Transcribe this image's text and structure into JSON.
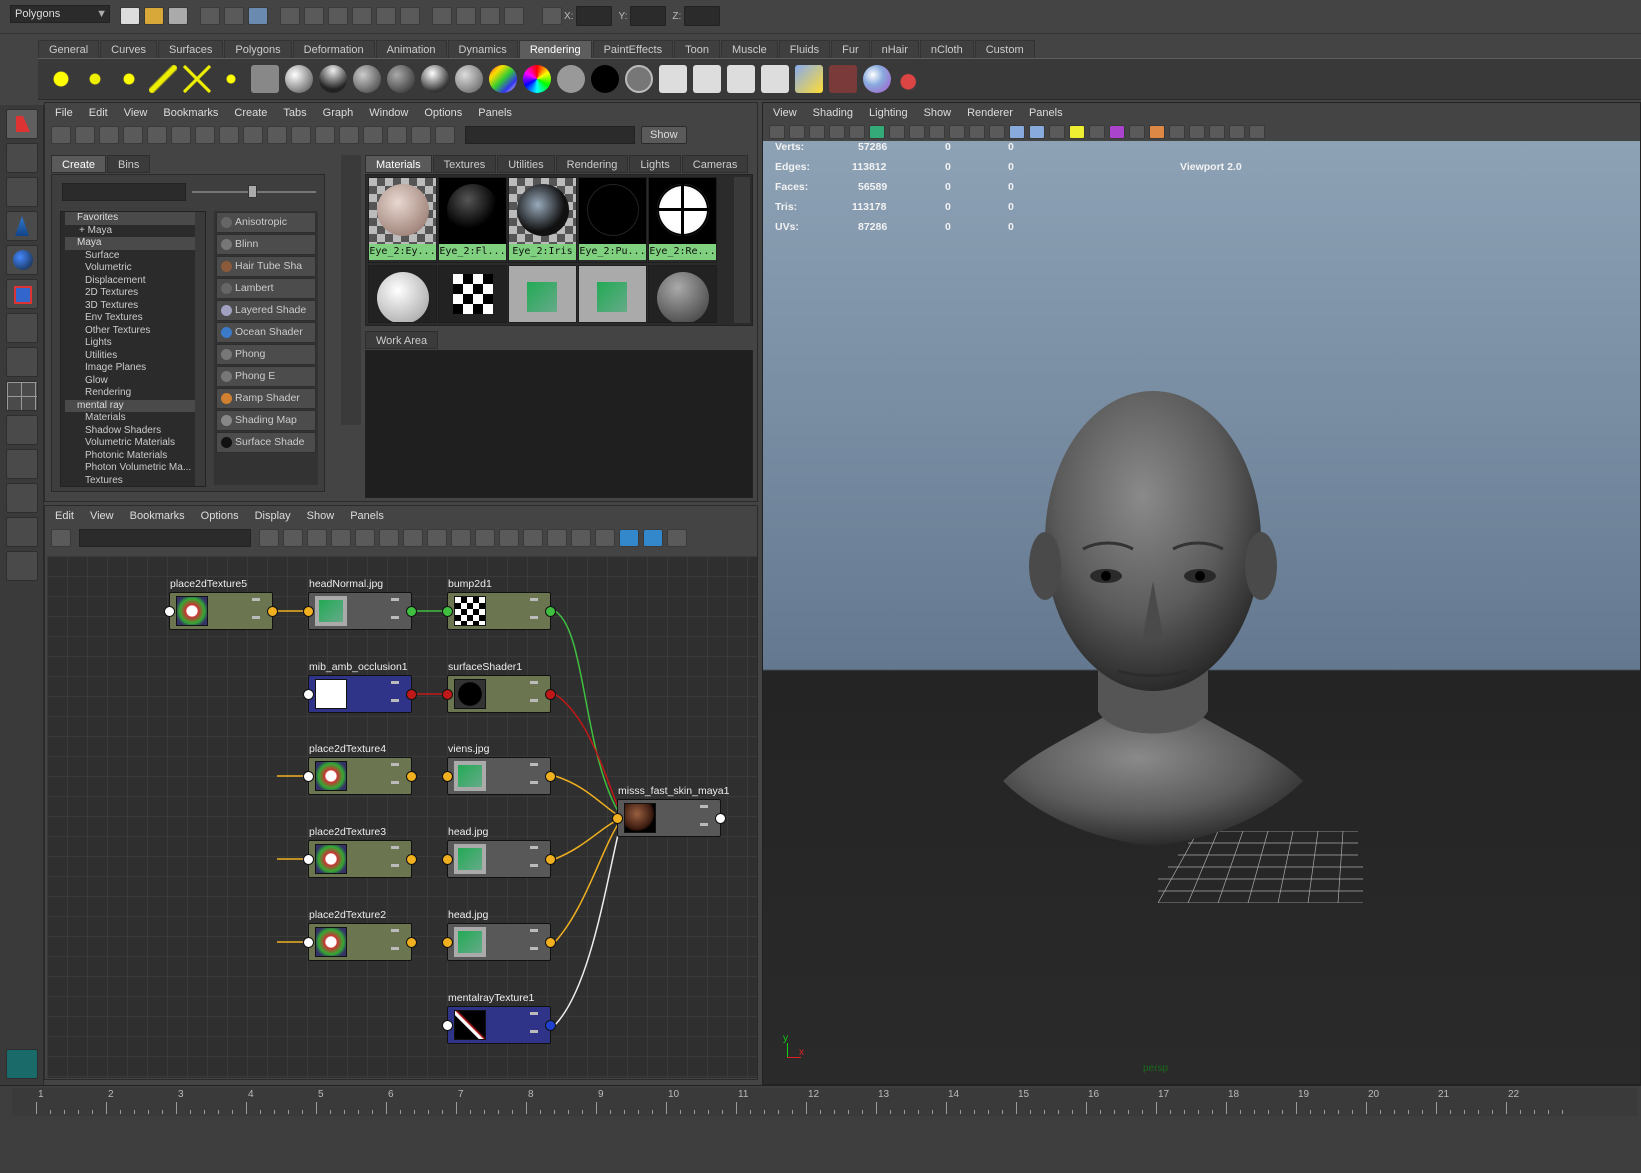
{
  "status_line": {
    "mode": "Polygons",
    "coord_labels": [
      "X:",
      "Y:",
      "Z:"
    ]
  },
  "shelf": {
    "tabs": [
      "General",
      "Curves",
      "Surfaces",
      "Polygons",
      "Deformation",
      "Animation",
      "Dynamics",
      "Rendering",
      "PaintEffects",
      "Toon",
      "Muscle",
      "Fluids",
      "Fur",
      "nHair",
      "nCloth",
      "Custom"
    ],
    "active_tab": "Rendering"
  },
  "hypershade": {
    "menu": [
      "File",
      "Edit",
      "View",
      "Bookmarks",
      "Create",
      "Tabs",
      "Graph",
      "Window",
      "Options",
      "Panels"
    ],
    "show_button": "Show",
    "left_tabs": [
      "Create",
      "Bins"
    ],
    "tree": [
      {
        "label": "Favorites",
        "type": "header"
      },
      {
        "label": "+ Maya",
        "type": "sub"
      },
      {
        "label": "Maya",
        "type": "header"
      },
      {
        "label": "Surface",
        "type": "item"
      },
      {
        "label": "Volumetric",
        "type": "item"
      },
      {
        "label": "Displacement",
        "type": "item"
      },
      {
        "label": "2D Textures",
        "type": "item"
      },
      {
        "label": "3D Textures",
        "type": "item"
      },
      {
        "label": "Env Textures",
        "type": "item"
      },
      {
        "label": "Other Textures",
        "type": "item"
      },
      {
        "label": "Lights",
        "type": "item"
      },
      {
        "label": "Utilities",
        "type": "item"
      },
      {
        "label": "Image Planes",
        "type": "item"
      },
      {
        "label": "Glow",
        "type": "item"
      },
      {
        "label": "Rendering",
        "type": "item"
      },
      {
        "label": "mental ray",
        "type": "header"
      },
      {
        "label": "Materials",
        "type": "item"
      },
      {
        "label": "Shadow Shaders",
        "type": "item"
      },
      {
        "label": "Volumetric Materials",
        "type": "item"
      },
      {
        "label": "Photonic Materials",
        "type": "item"
      },
      {
        "label": "Photon Volumetric Ma...",
        "type": "item"
      },
      {
        "label": "Textures",
        "type": "item"
      }
    ],
    "node_list": [
      {
        "label": "Anisotropic",
        "color": "#666"
      },
      {
        "label": "Blinn",
        "color": "#777"
      },
      {
        "label": "Hair Tube Sha",
        "color": "#8a5a3a"
      },
      {
        "label": "Lambert",
        "color": "#666"
      },
      {
        "label": "Layered Shade",
        "color": "#a0a0c0"
      },
      {
        "label": "Ocean Shader",
        "color": "#3a7ac8"
      },
      {
        "label": "Phong",
        "color": "#777"
      },
      {
        "label": "Phong E",
        "color": "#777"
      },
      {
        "label": "Ramp Shader",
        "color": "#d08030"
      },
      {
        "label": "Shading Map",
        "color": "#888"
      },
      {
        "label": "Surface Shade",
        "color": "#111"
      }
    ],
    "material_tabs": [
      "Materials",
      "Textures",
      "Utilities",
      "Rendering",
      "Lights",
      "Cameras"
    ],
    "active_material_tab": "Materials",
    "swatch_labels": [
      "Eye_2:Ey...",
      "Eye_2:Fl...",
      "Eye_2:Iris",
      "Eye_2:Pu...",
      "Eye_2:Re..."
    ],
    "work_area_label": "Work Area"
  },
  "node_editor": {
    "menu": [
      "Edit",
      "View",
      "Bookmarks",
      "Options",
      "Display",
      "Show",
      "Panels"
    ],
    "nodes": {
      "n1": "place2dTexture5",
      "n2": "headNormal.jpg",
      "n3": "bump2d1",
      "n4": "mib_amb_occlusion1",
      "n5": "surfaceShader1",
      "n6": "place2dTexture4",
      "n7": "viens.jpg",
      "n8": "place2dTexture3",
      "n9": "head.jpg",
      "n10": "place2dTexture2",
      "n11": "head.jpg",
      "n12": "mentalrayTexture1",
      "n13": "misss_fast_skin_maya1"
    }
  },
  "viewport": {
    "menu": [
      "View",
      "Shading",
      "Lighting",
      "Show",
      "Renderer",
      "Panels"
    ],
    "hud_rows": [
      {
        "label": "Verts:",
        "v1": "57286",
        "v2": "0",
        "v3": "0"
      },
      {
        "label": "Edges:",
        "v1": "113812",
        "v2": "0",
        "v3": "0"
      },
      {
        "label": "Faces:",
        "v1": "56589",
        "v2": "0",
        "v3": "0"
      },
      {
        "label": "Tris:",
        "v1": "113178",
        "v2": "0",
        "v3": "0"
      },
      {
        "label": "UVs:",
        "v1": "87286",
        "v2": "0",
        "v3": "0"
      }
    ],
    "renderer_label": "Viewport 2.0",
    "camera_label": "persp",
    "axis_y": "y",
    "axis_x": "x"
  },
  "timeline": {
    "frames": [
      "1",
      "2",
      "3",
      "4",
      "5",
      "6",
      "7",
      "8",
      "9",
      "10",
      "11",
      "12",
      "13",
      "14",
      "15",
      "16",
      "17",
      "18",
      "19",
      "20",
      "21",
      "22"
    ]
  },
  "colors": {
    "accent_swatch": "#7fd17f",
    "node_green": "#6b7550",
    "node_blue": "#2f3488",
    "conn_yellow": "#f0b020",
    "conn_green": "#3fbf3f",
    "conn_red": "#c01818"
  }
}
